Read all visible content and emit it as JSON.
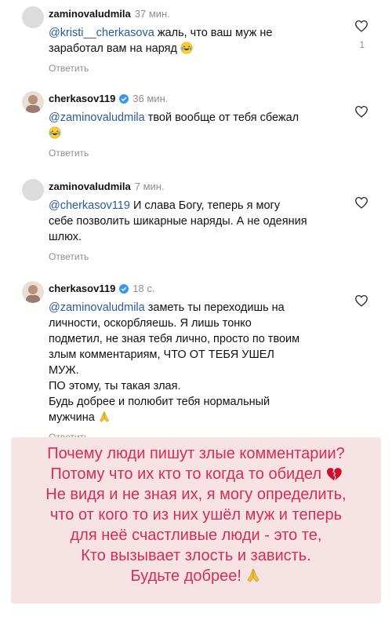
{
  "comments": [
    {
      "username": "zaminovaludmila",
      "time": "37 мин.",
      "mention": "@kristi__cherkasova",
      "text": " жаль, что ваш муж не заработал вам на наряд",
      "reply": "Ответить",
      "likes": "1"
    },
    {
      "username": "cherkasov119",
      "time": "36 мин.",
      "mention": "@zaminovaludmila",
      "text": " твой вообще от тебя сбежал",
      "reply": "Ответить"
    },
    {
      "username": "zaminovaludmila",
      "time": "7 мин.",
      "mention": "@cherkasov119",
      "text": " И слава Богу, теперь я могу себе позволить шикарные наряды. А не одеяния шлюх.",
      "reply": "Ответить"
    },
    {
      "username": "cherkasov119",
      "time": "18 с.",
      "mention": "@zaminovaludmila",
      "text": " заметь ты переходишь на личности, оскорбляешь. Я лишь тонко подметил, не зная тебя лично, просто по твоим злым комментариям, ЧТО ОТ ТЕБЯ УШЕЛ МУЖ.",
      "text2": "ПО этому, ты такая злая.",
      "text3": "Будь добрее и полюбит тебя нормальный мужчина",
      "reply": "Ответить"
    }
  ],
  "caption": {
    "line1": "Почему люди пишут злые комментарии?",
    "line2": "Потому что их кто то когда то обидел",
    "line3": "Не видя и не зная их, я могу определить,",
    "line4": "что от кого то из них ушёл муж и теперь",
    "line5": "для неё счастливые люди - это те,",
    "line6": "Кто вызывает злость и зависть.",
    "line7": "Будьте добрее!"
  },
  "colors": {
    "mention": "#2a5b99",
    "caption_text": "#d72d55",
    "caption_bg": "#f7e2e4",
    "verified": "#3897f0"
  },
  "icons": [
    "heart-outline-icon",
    "verified-badge-icon",
    "laughing-emoji-icon",
    "broken-heart-icon",
    "praying-hands-icon"
  ]
}
